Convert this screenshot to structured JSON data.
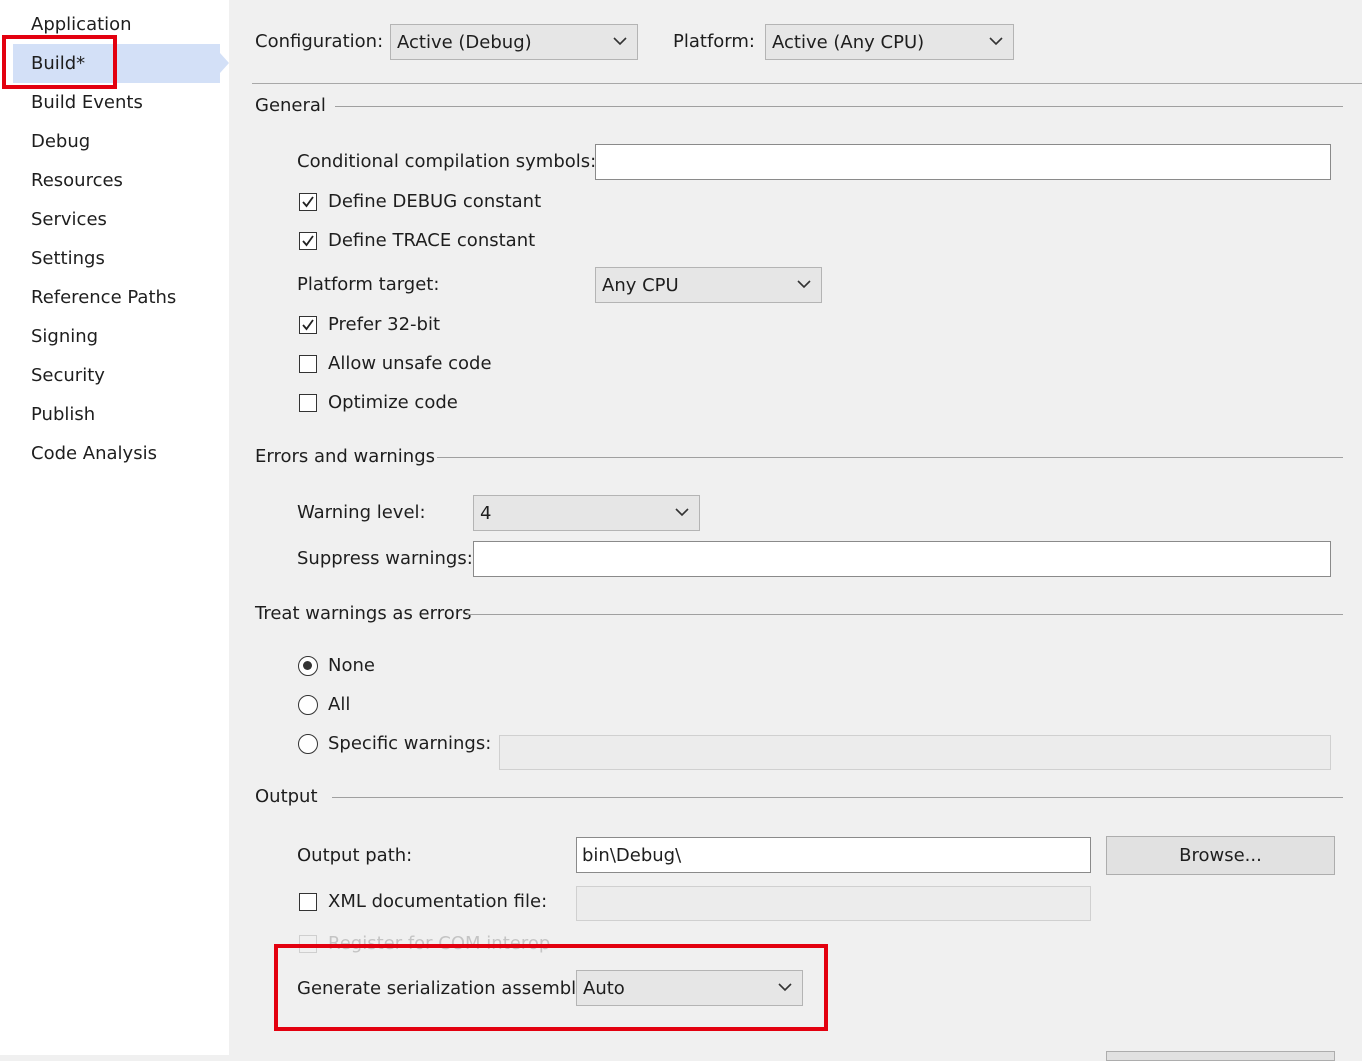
{
  "sidebar": {
    "items": [
      {
        "label": "Application"
      },
      {
        "label": "Build*"
      },
      {
        "label": "Build Events"
      },
      {
        "label": "Debug"
      },
      {
        "label": "Resources"
      },
      {
        "label": "Services"
      },
      {
        "label": "Settings"
      },
      {
        "label": "Reference Paths"
      },
      {
        "label": "Signing"
      },
      {
        "label": "Security"
      },
      {
        "label": "Publish"
      },
      {
        "label": "Code Analysis"
      }
    ],
    "selected": "Build*"
  },
  "header": {
    "configuration_label": "Configuration:",
    "configuration_value": "Active (Debug)",
    "platform_label": "Platform:",
    "platform_value": "Active (Any CPU)"
  },
  "general": {
    "title": "General",
    "conditional_symbols_label": "Conditional compilation symbols:",
    "conditional_symbols_value": "",
    "define_debug": {
      "label": "Define DEBUG constant",
      "checked": true
    },
    "define_trace": {
      "label": "Define TRACE constant",
      "checked": true
    },
    "platform_target_label": "Platform target:",
    "platform_target_value": "Any CPU",
    "prefer_32bit": {
      "label": "Prefer 32-bit",
      "checked": true
    },
    "allow_unsafe": {
      "label": "Allow unsafe code",
      "checked": false
    },
    "optimize": {
      "label": "Optimize code",
      "checked": false
    }
  },
  "errors": {
    "title": "Errors and warnings",
    "warning_level_label": "Warning level:",
    "warning_level_value": "4",
    "suppress_label": "Suppress warnings:",
    "suppress_value": ""
  },
  "treat": {
    "title": "Treat warnings as errors",
    "none_label": "None",
    "all_label": "All",
    "specific_label": "Specific warnings:",
    "selected": "None"
  },
  "output": {
    "title": "Output",
    "output_path_label": "Output path:",
    "output_path_value": "bin\\Debug\\",
    "browse_label": "Browse...",
    "xml_doc": {
      "label": "XML documentation file:",
      "checked": false
    },
    "register_com": {
      "label": "Register for COM interop",
      "checked": false
    },
    "serialization_label": "Generate serialization assembly:",
    "serialization_value": "Auto"
  },
  "colors": {
    "highlight": "#e3000f",
    "selection": "#d3e0f7"
  }
}
